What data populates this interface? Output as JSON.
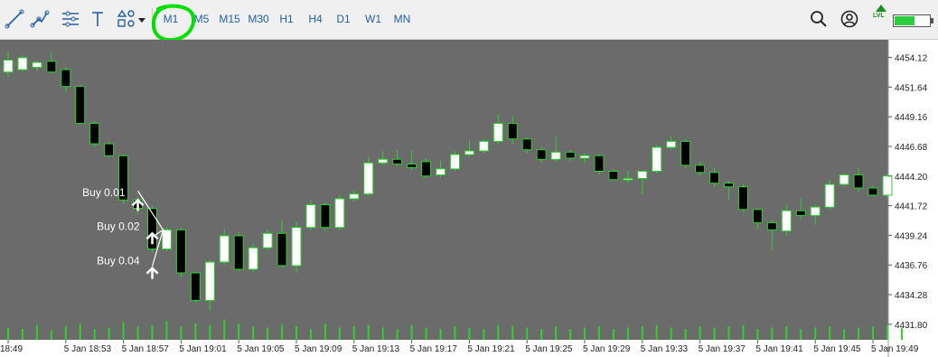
{
  "toolbar": {
    "drawing_tools": [
      "line-tool-icon",
      "trendline-tool-icon",
      "fibonacci-tool-icon",
      "text-tool-icon",
      "shapes-tool-icon"
    ],
    "timeframes": [
      "M1",
      "M5",
      "M15",
      "M30",
      "H1",
      "H4",
      "D1",
      "W1",
      "MN"
    ],
    "active_timeframe": "M1",
    "highlight_color": "#00e000",
    "right_icons": [
      "search-icon",
      "account-icon",
      "signal-level-icon"
    ],
    "lvl_label": "LVL",
    "battery_level": 0.55
  },
  "chart_data": {
    "type": "candlestick",
    "title": "",
    "colors": {
      "background": "#6b6b6b",
      "bull_body": "#ffffff",
      "bear_body": "#000000",
      "candle_outline": "#2fd02f",
      "volume": "#2fd02f",
      "axis_bg": "#ffffff"
    },
    "ylim": [
      4430.5,
      4455.6
    ],
    "y_ticks": [
      "4454.12",
      "4451.64",
      "4449.16",
      "4446.68",
      "4444.20",
      "4441.72",
      "4439.24",
      "4436.76",
      "4434.28",
      "4431.80"
    ],
    "y_tick_values": [
      4454.12,
      4451.64,
      4449.16,
      4446.68,
      4444.2,
      4441.72,
      4439.24,
      4436.76,
      4434.28,
      4431.8
    ],
    "x_ticks": [
      "18:49",
      "5 Jan 18:53",
      "5 Jan 18:57",
      "5 Jan 19:01",
      "5 Jan 19:05",
      "5 Jan 19:09",
      "5 Jan 19:13",
      "5 Jan 19:17",
      "5 Jan 19:21",
      "5 Jan 19:25",
      "5 Jan 19:29",
      "5 Jan 19:33",
      "5 Jan 19:37",
      "5 Jan 19:41",
      "5 Jan 19:45",
      "5 Jan 19:49"
    ],
    "candles": [
      {
        "t": "18:49",
        "o": 4452.9,
        "h": 4454.6,
        "l": 4452.5,
        "c": 4453.9
      },
      {
        "t": "18:50",
        "o": 4453.1,
        "h": 4454.3,
        "l": 4452.9,
        "c": 4454.1
      },
      {
        "t": "18:51",
        "o": 4453.3,
        "h": 4453.8,
        "l": 4453.0,
        "c": 4453.7
      },
      {
        "t": "18:52",
        "o": 4453.8,
        "h": 4454.5,
        "l": 4452.8,
        "c": 4452.9
      },
      {
        "t": "18:53",
        "o": 4453.1,
        "h": 4453.3,
        "l": 4451.2,
        "c": 4451.7
      },
      {
        "t": "18:54",
        "o": 4451.7,
        "h": 4451.9,
        "l": 4448.5,
        "c": 4448.6
      },
      {
        "t": "18:55",
        "o": 4448.6,
        "h": 4448.8,
        "l": 4446.6,
        "c": 4446.9
      },
      {
        "t": "18:56",
        "o": 4446.9,
        "h": 4447.1,
        "l": 4445.8,
        "c": 4445.9
      },
      {
        "t": "18:57",
        "o": 4445.9,
        "h": 4446.0,
        "l": 4441.9,
        "c": 4442.2
      },
      {
        "t": "18:58",
        "o": 4442.2,
        "h": 4442.4,
        "l": 4441.0,
        "c": 4441.5
      },
      {
        "t": "18:59",
        "o": 4441.5,
        "h": 4441.7,
        "l": 4437.8,
        "c": 4438.1
      },
      {
        "t": "19:00",
        "o": 4438.1,
        "h": 4440.0,
        "l": 4437.9,
        "c": 4439.7
      },
      {
        "t": "19:01",
        "o": 4439.7,
        "h": 4439.9,
        "l": 4435.7,
        "c": 4436.1
      },
      {
        "t": "19:02",
        "o": 4436.1,
        "h": 4436.2,
        "l": 4433.6,
        "c": 4433.8
      },
      {
        "t": "19:03",
        "o": 4433.8,
        "h": 4437.2,
        "l": 4432.9,
        "c": 4437.0
      },
      {
        "t": "19:04",
        "o": 4437.0,
        "h": 4439.8,
        "l": 4436.8,
        "c": 4439.2
      },
      {
        "t": "19:05",
        "o": 4439.2,
        "h": 4439.5,
        "l": 4436.2,
        "c": 4436.4
      },
      {
        "t": "19:06",
        "o": 4436.4,
        "h": 4438.6,
        "l": 4436.2,
        "c": 4438.2
      },
      {
        "t": "19:07",
        "o": 4438.2,
        "h": 4439.8,
        "l": 4438.0,
        "c": 4439.4
      },
      {
        "t": "19:08",
        "o": 4439.4,
        "h": 4440.5,
        "l": 4436.5,
        "c": 4436.7
      },
      {
        "t": "19:09",
        "o": 4436.7,
        "h": 4440.4,
        "l": 4436.1,
        "c": 4439.9
      },
      {
        "t": "19:10",
        "o": 4439.9,
        "h": 4442.2,
        "l": 4439.7,
        "c": 4441.8
      },
      {
        "t": "19:11",
        "o": 4441.8,
        "h": 4442.0,
        "l": 4439.6,
        "c": 4439.9
      },
      {
        "t": "19:12",
        "o": 4439.9,
        "h": 4442.6,
        "l": 4439.7,
        "c": 4442.3
      },
      {
        "t": "19:13",
        "o": 4442.3,
        "h": 4443.0,
        "l": 4442.1,
        "c": 4442.7
      },
      {
        "t": "19:14",
        "o": 4442.7,
        "h": 4445.8,
        "l": 4442.5,
        "c": 4445.3
      },
      {
        "t": "19:15",
        "o": 4445.3,
        "h": 4446.3,
        "l": 4445.1,
        "c": 4445.6
      },
      {
        "t": "19:16",
        "o": 4445.6,
        "h": 4446.4,
        "l": 4445.0,
        "c": 4445.2
      },
      {
        "t": "19:17",
        "o": 4445.2,
        "h": 4446.4,
        "l": 4444.7,
        "c": 4444.9
      },
      {
        "t": "19:18",
        "o": 4445.4,
        "h": 4445.7,
        "l": 4444.0,
        "c": 4444.2
      },
      {
        "t": "19:19",
        "o": 4444.3,
        "h": 4445.5,
        "l": 4444.1,
        "c": 4444.8
      },
      {
        "t": "19:20",
        "o": 4444.8,
        "h": 4446.3,
        "l": 4444.6,
        "c": 4446.0
      },
      {
        "t": "19:21",
        "o": 4446.0,
        "h": 4447.2,
        "l": 4445.8,
        "c": 4446.3
      },
      {
        "t": "19:22",
        "o": 4446.3,
        "h": 4447.3,
        "l": 4446.1,
        "c": 4447.1
      },
      {
        "t": "19:23",
        "o": 4447.1,
        "h": 4449.4,
        "l": 4446.9,
        "c": 4448.6
      },
      {
        "t": "19:24",
        "o": 4448.6,
        "h": 4449.2,
        "l": 4446.9,
        "c": 4447.3
      },
      {
        "t": "19:25",
        "o": 4447.3,
        "h": 4447.4,
        "l": 4446.1,
        "c": 4446.4
      },
      {
        "t": "19:26",
        "o": 4446.4,
        "h": 4446.6,
        "l": 4445.4,
        "c": 4445.6
      },
      {
        "t": "19:27",
        "o": 4445.6,
        "h": 4447.5,
        "l": 4445.4,
        "c": 4446.2
      },
      {
        "t": "19:28",
        "o": 4446.2,
        "h": 4446.4,
        "l": 4445.4,
        "c": 4445.7
      },
      {
        "t": "19:29",
        "o": 4445.7,
        "h": 4446.1,
        "l": 4445.3,
        "c": 4445.9
      },
      {
        "t": "19:30",
        "o": 4445.9,
        "h": 4446.0,
        "l": 4444.3,
        "c": 4444.6
      },
      {
        "t": "19:31",
        "o": 4444.6,
        "h": 4444.8,
        "l": 4443.8,
        "c": 4443.9
      },
      {
        "t": "19:32",
        "o": 4443.9,
        "h": 4444.6,
        "l": 4443.6,
        "c": 4444.0
      },
      {
        "t": "19:33",
        "o": 4444.0,
        "h": 4444.7,
        "l": 4442.7,
        "c": 4444.6
      },
      {
        "t": "19:34",
        "o": 4444.6,
        "h": 4446.8,
        "l": 4444.4,
        "c": 4446.6
      },
      {
        "t": "19:35",
        "o": 4446.6,
        "h": 4447.6,
        "l": 4446.4,
        "c": 4447.1
      },
      {
        "t": "19:36",
        "o": 4447.1,
        "h": 4447.3,
        "l": 4444.8,
        "c": 4445.1
      },
      {
        "t": "19:37",
        "o": 4445.1,
        "h": 4445.4,
        "l": 4444.2,
        "c": 4444.5
      },
      {
        "t": "19:38",
        "o": 4444.5,
        "h": 4444.9,
        "l": 4443.3,
        "c": 4443.6
      },
      {
        "t": "19:39",
        "o": 4443.6,
        "h": 4443.8,
        "l": 4442.2,
        "c": 4443.3
      },
      {
        "t": "19:40",
        "o": 4443.3,
        "h": 4443.5,
        "l": 4441.2,
        "c": 4441.4
      },
      {
        "t": "19:41",
        "o": 4441.4,
        "h": 4441.6,
        "l": 4439.7,
        "c": 4440.3
      },
      {
        "t": "19:42",
        "o": 4440.3,
        "h": 4440.5,
        "l": 4438.0,
        "c": 4439.7
      },
      {
        "t": "19:43",
        "o": 4439.6,
        "h": 4441.8,
        "l": 4439.2,
        "c": 4441.3
      },
      {
        "t": "19:44",
        "o": 4441.3,
        "h": 4442.4,
        "l": 4440.6,
        "c": 4440.9
      },
      {
        "t": "19:45",
        "o": 4440.9,
        "h": 4441.8,
        "l": 4440.1,
        "c": 4441.6
      },
      {
        "t": "19:46",
        "o": 4441.6,
        "h": 4443.9,
        "l": 4441.4,
        "c": 4443.5
      },
      {
        "t": "19:47",
        "o": 4443.5,
        "h": 4444.4,
        "l": 4443.3,
        "c": 4444.3
      },
      {
        "t": "19:48",
        "o": 4444.3,
        "h": 4444.9,
        "l": 4442.8,
        "c": 4443.2
      },
      {
        "t": "19:49",
        "o": 4443.2,
        "h": 4443.4,
        "l": 4442.5,
        "c": 4442.6
      },
      {
        "t": "19:50",
        "o": 4442.6,
        "h": 4444.4,
        "l": 4442.4,
        "c": 4444.2
      }
    ],
    "volumes": [
      0.45,
      0.4,
      0.55,
      0.35,
      0.5,
      0.6,
      0.4,
      0.45,
      0.65,
      0.5,
      0.55,
      0.7,
      0.5,
      0.6,
      0.55,
      0.75,
      0.6,
      0.5,
      0.45,
      0.55,
      0.5,
      0.4,
      0.6,
      0.45,
      0.5,
      0.55,
      0.45,
      0.4,
      0.55,
      0.45,
      0.4,
      0.5,
      0.45,
      0.4,
      0.55,
      0.5,
      0.45,
      0.4,
      0.5,
      0.4,
      0.45,
      0.5,
      0.4,
      0.45,
      0.5,
      0.55,
      0.45,
      0.4,
      0.5,
      0.45,
      0.5,
      0.55,
      0.4,
      0.45,
      0.5,
      0.4,
      0.45,
      0.5,
      0.4,
      0.45,
      0.5,
      0.55,
      0.45
    ],
    "annotations": [
      {
        "text": "Buy 0.01",
        "price": 4442.2,
        "candle": 9
      },
      {
        "text": "Buy 0.02",
        "price": 4439.4,
        "candle": 10
      },
      {
        "text": "Buy 0.04",
        "price": 4436.5,
        "candle": 10
      }
    ]
  }
}
